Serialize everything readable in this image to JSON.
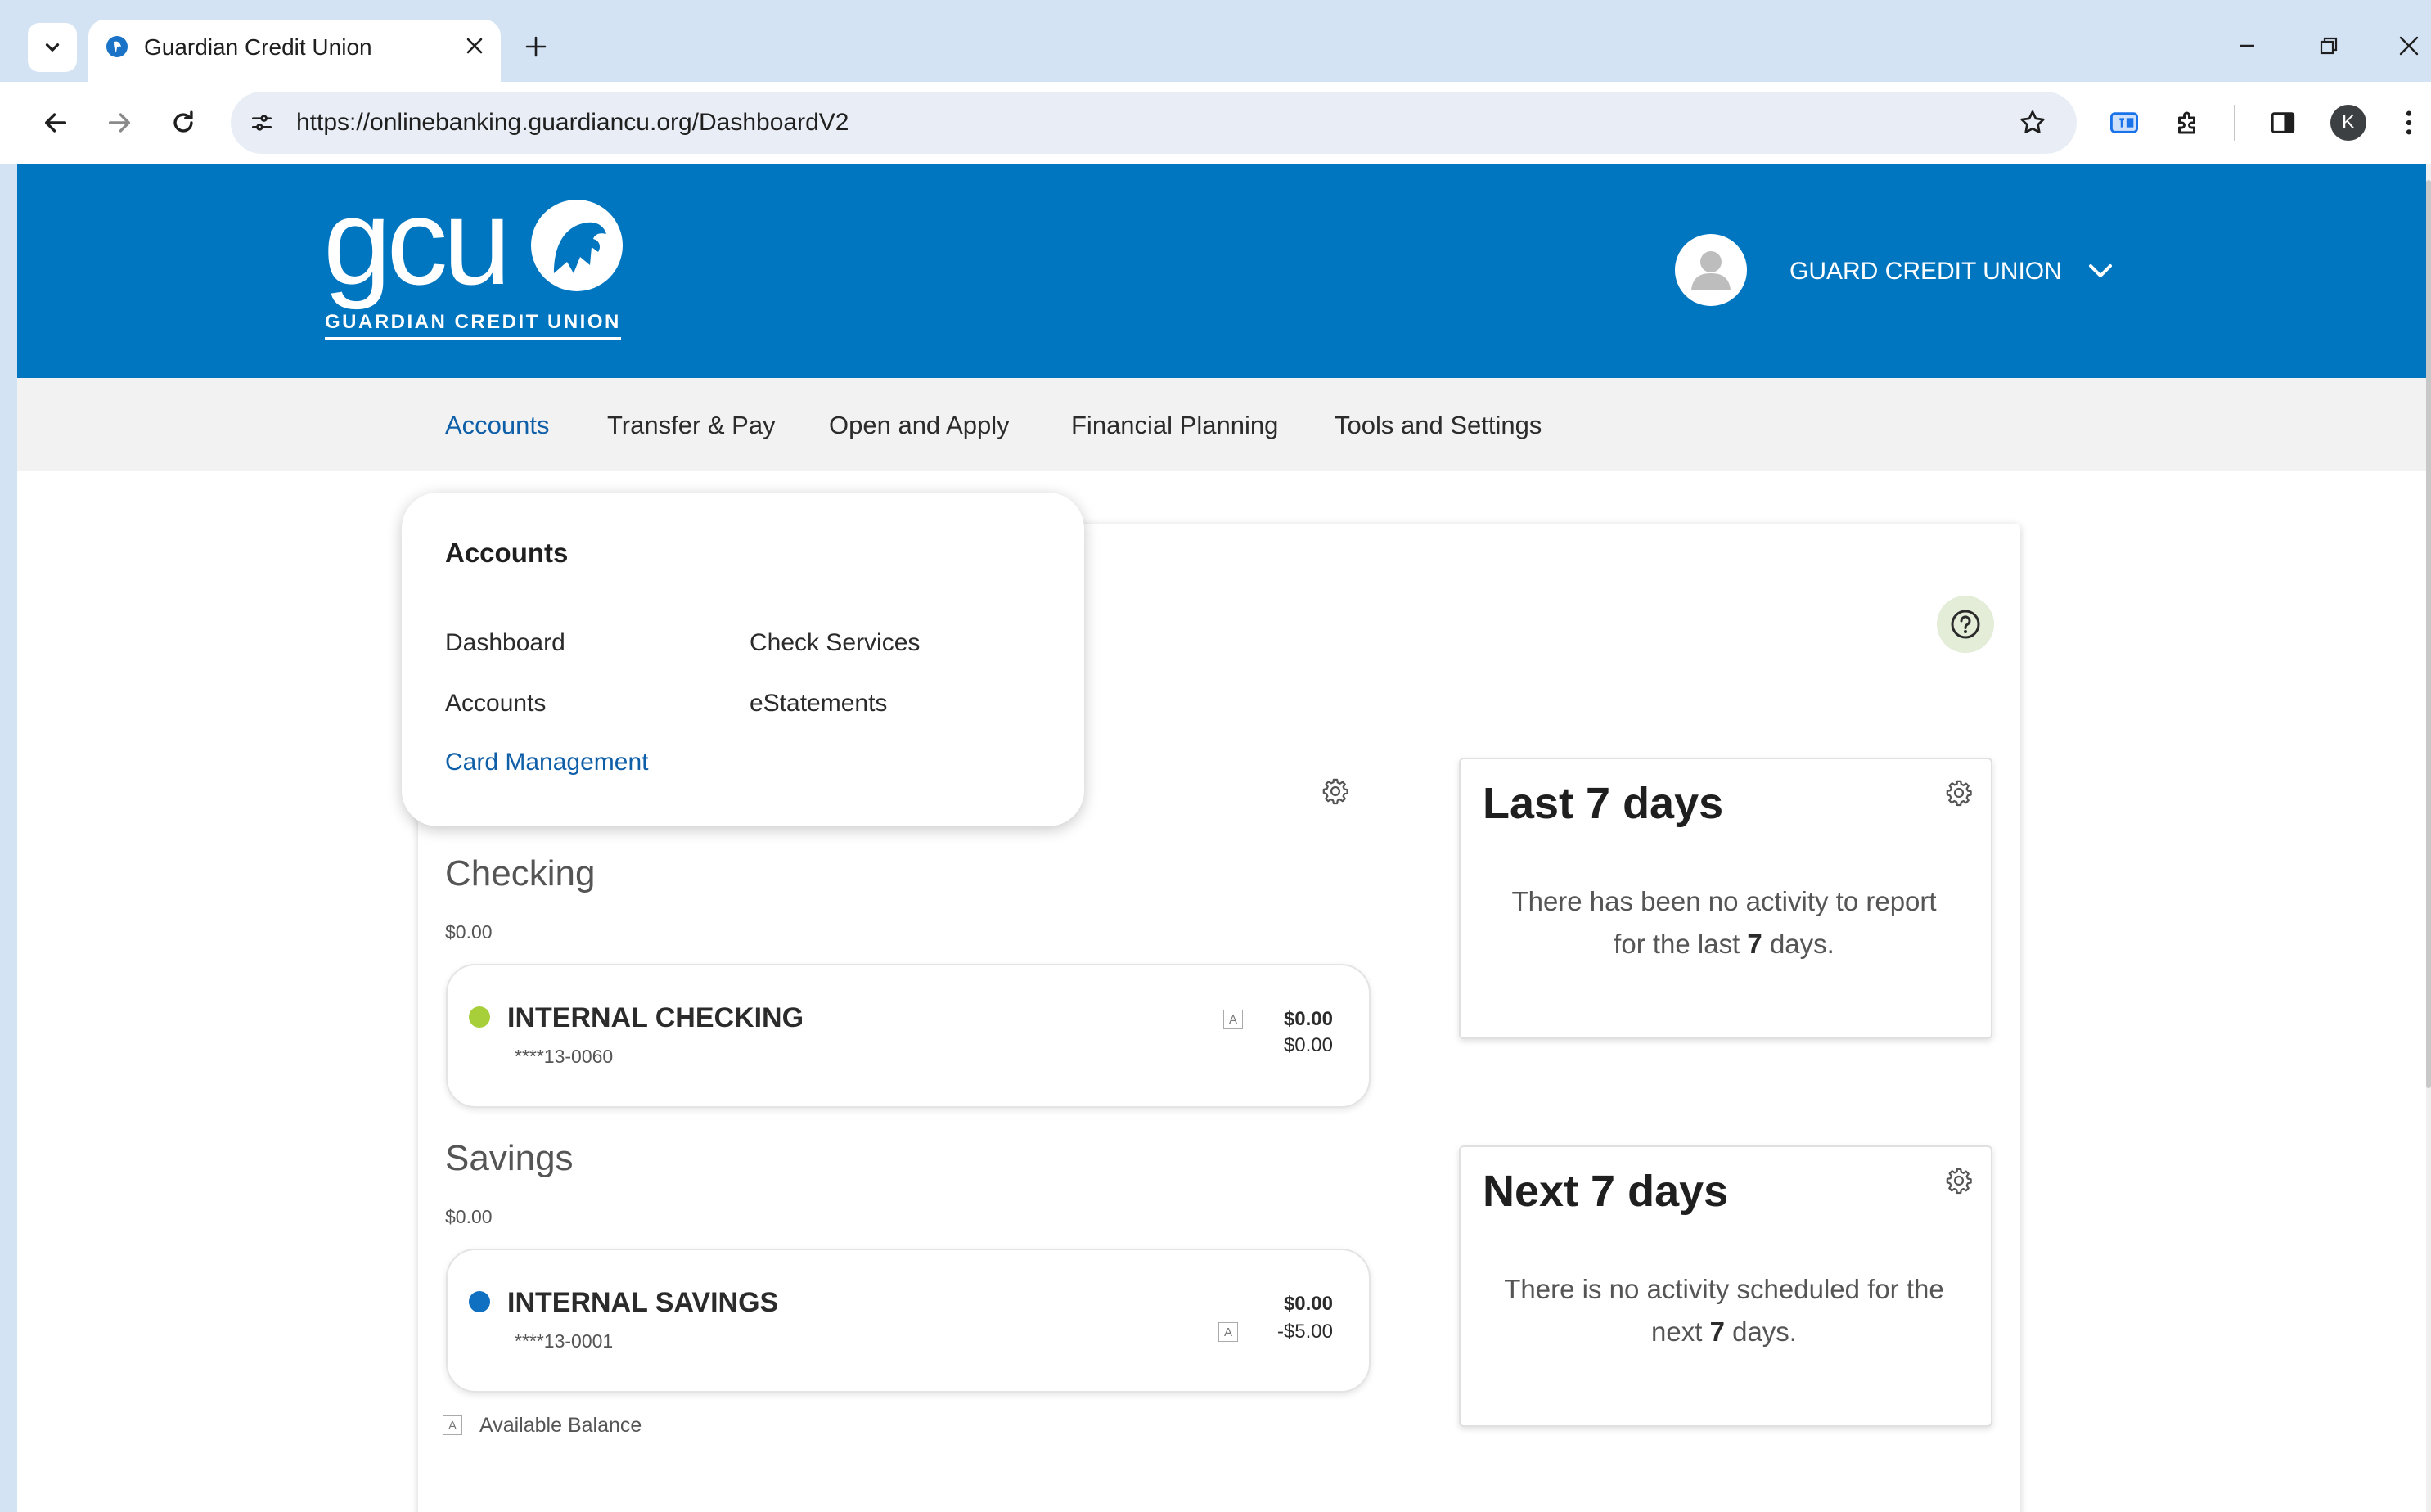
{
  "browser": {
    "tab_title": "Guardian Credit Union",
    "url": "https://onlinebanking.guardiancu.org/DashboardV2",
    "profile_initial": "K"
  },
  "header": {
    "logo_text": "gcu",
    "logo_subtitle": "GUARDIAN CREDIT UNION",
    "user_name": "GUARD CREDIT UNION"
  },
  "nav": {
    "items": [
      {
        "label": "Accounts",
        "active": true
      },
      {
        "label": "Transfer & Pay",
        "active": false
      },
      {
        "label": "Open and Apply",
        "active": false
      },
      {
        "label": "Financial Planning",
        "active": false
      },
      {
        "label": "Tools and Settings",
        "active": false
      }
    ]
  },
  "dropdown": {
    "heading": "Accounts",
    "items": [
      "Dashboard",
      "Check Services",
      "Accounts",
      "eStatements",
      "Card Management"
    ]
  },
  "accounts": {
    "checking": {
      "title": "Checking",
      "total": "$0.00",
      "name": "INTERNAL CHECKING",
      "number": "****13-0060",
      "available_balance": "$0.00",
      "current_balance": "$0.00",
      "dot_color": "#a6cf3a"
    },
    "savings": {
      "title": "Savings",
      "total": "$0.00",
      "name": "INTERNAL SAVINGS",
      "number": "****13-0001",
      "current_balance": "$0.00",
      "available_balance": "-$5.00",
      "dot_color": "#0f6fc0"
    },
    "badge_letter": "A",
    "legend_label": "Available Balance"
  },
  "activity": {
    "last": {
      "title": "Last 7 days",
      "body_prefix": "There has been no activity to report for the last ",
      "body_number": "7",
      "body_suffix": " days."
    },
    "next": {
      "title": "Next 7 days",
      "body_prefix": "There is no activity scheduled for the next ",
      "body_number": "7",
      "body_suffix": " days."
    }
  },
  "colors": {
    "brand_blue": "#0076c0",
    "link_blue": "#0f5fa8",
    "help_bg": "#e3edd8"
  }
}
